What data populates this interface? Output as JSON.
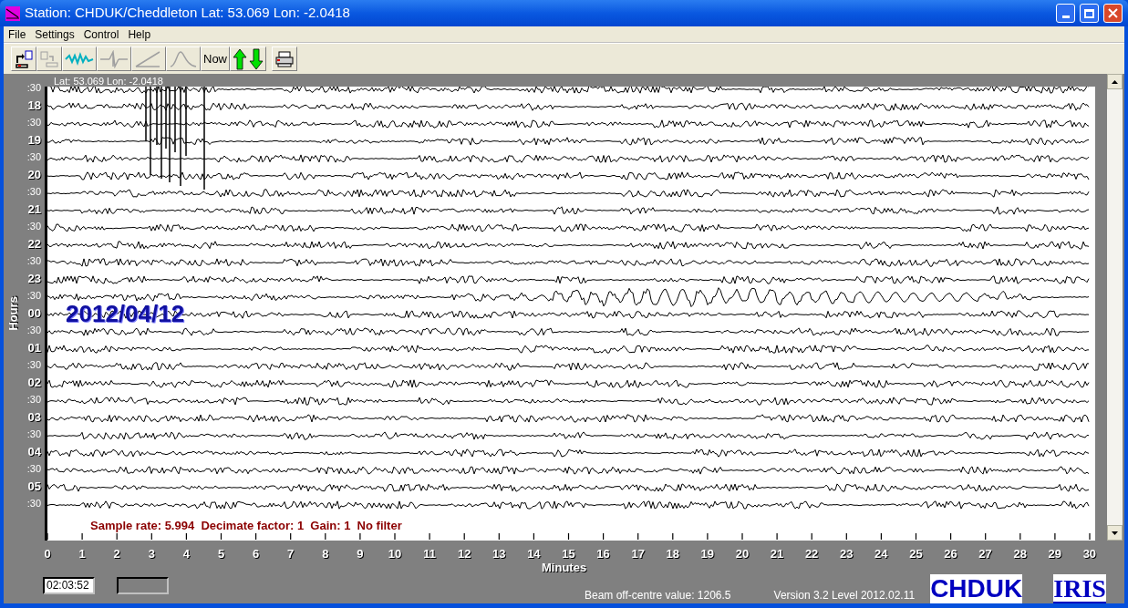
{
  "window": {
    "title": "Station: CHDUK/Cheddleton Lat: 53.069 Lon: -2.0418"
  },
  "menu": [
    "File",
    "Settings",
    "Control",
    "Help"
  ],
  "toolbar": [
    {
      "kind": "export",
      "disabled": false
    },
    {
      "kind": "copy",
      "disabled": true
    },
    {
      "kind": "wave",
      "disabled": false
    },
    {
      "kind": "filter",
      "disabled": true
    },
    {
      "kind": "ramp",
      "disabled": true
    },
    {
      "kind": "peak",
      "disabled": true
    },
    {
      "kind": "text",
      "label": "Now",
      "disabled": false
    },
    {
      "kind": "updown",
      "disabled": false
    },
    {
      "kind": "print",
      "disabled": false
    }
  ],
  "plot": {
    "location": "Lat: 53.069 Lon: -2.0418",
    "date": "2012/04/12",
    "info": "Sample rate: 5.994  Decimate factor: 1  Gain: 1  No filter",
    "y_axis": {
      "label": "Hours",
      "rows": [
        {
          "text": ":30",
          "kind": "half"
        },
        {
          "text": "18",
          "kind": "hour"
        },
        {
          "text": ":30",
          "kind": "half"
        },
        {
          "text": "19",
          "kind": "hour"
        },
        {
          "text": ":30",
          "kind": "half"
        },
        {
          "text": "20",
          "kind": "hour"
        },
        {
          "text": ":30",
          "kind": "half"
        },
        {
          "text": "21",
          "kind": "hour"
        },
        {
          "text": ":30",
          "kind": "half"
        },
        {
          "text": "22",
          "kind": "hour"
        },
        {
          "text": ":30",
          "kind": "half"
        },
        {
          "text": "23",
          "kind": "hour"
        },
        {
          "text": ":30",
          "kind": "half"
        },
        {
          "text": "00",
          "kind": "hour"
        },
        {
          "text": ":30",
          "kind": "half"
        },
        {
          "text": "01",
          "kind": "hour"
        },
        {
          "text": ":30",
          "kind": "half"
        },
        {
          "text": "02",
          "kind": "hour"
        },
        {
          "text": ":30",
          "kind": "half"
        },
        {
          "text": "03",
          "kind": "hour"
        },
        {
          "text": ":30",
          "kind": "half"
        },
        {
          "text": "04",
          "kind": "hour"
        },
        {
          "text": ":30",
          "kind": "half"
        },
        {
          "text": "05",
          "kind": "hour"
        },
        {
          "text": ":30",
          "kind": "half"
        }
      ]
    },
    "x_axis": {
      "label": "Minutes",
      "ticks": [
        "0",
        "1",
        "2",
        "3",
        "4",
        "5",
        "6",
        "7",
        "8",
        "9",
        "10",
        "11",
        "12",
        "13",
        "14",
        "15",
        "16",
        "17",
        "18",
        "19",
        "20",
        "21",
        "22",
        "23",
        "24",
        "25",
        "26",
        "27",
        "28",
        "29",
        "30"
      ]
    }
  },
  "status": {
    "time": "02:03:52",
    "beam": "Beam off-centre value: 1206.5",
    "version": "Version 3.2 Level 2012.02.11",
    "station_logo": "CHDUK",
    "network_logo": "IRIS"
  }
}
